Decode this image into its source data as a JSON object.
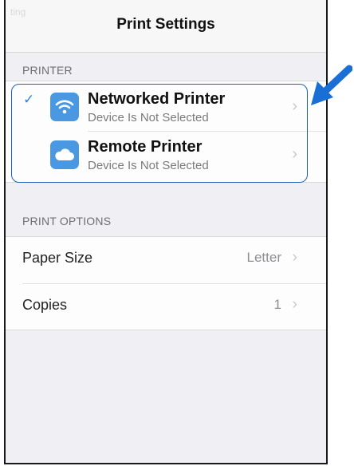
{
  "navbar": {
    "title": "Print Settings",
    "ghost_text": "ting"
  },
  "printer_section": {
    "header": "PRINTER",
    "items": [
      {
        "title": "Networked Printer",
        "subtitle": "Device Is Not Selected",
        "selected": true,
        "icon": "wifi-icon"
      },
      {
        "title": "Remote Printer",
        "subtitle": "Device Is Not Selected",
        "selected": false,
        "icon": "cloud-icon"
      }
    ]
  },
  "options_section": {
    "header": "PRINT OPTIONS",
    "items": [
      {
        "label": "Paper Size",
        "value": "Letter"
      },
      {
        "label": "Copies",
        "value": "1"
      }
    ]
  },
  "colors": {
    "accent": "#2d83dc",
    "icon_bg": "#4a98e2",
    "highlight_border": "#1f62b5",
    "arrow": "#1a6fd6"
  },
  "glyphs": {
    "check": "✓",
    "chevron": "›"
  }
}
